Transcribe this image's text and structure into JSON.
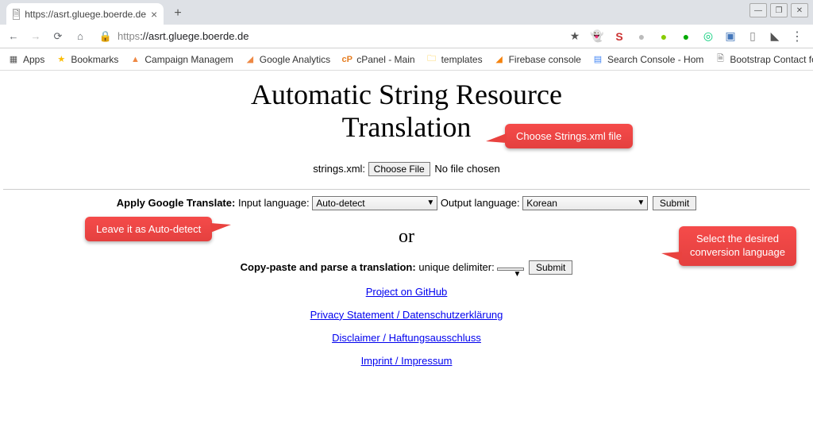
{
  "browser": {
    "tab_title": "https://asrt.gluege.boerde.de",
    "url_proto": "https",
    "url_rest": "://asrt.gluege.boerde.de",
    "new_tab": "+",
    "window_min": "—",
    "window_max": "❐",
    "window_close": "✕"
  },
  "bookmarks": {
    "apps": "Apps",
    "bm": "Bookmarks",
    "cm": "Campaign Managem",
    "ga": "Google Analytics",
    "cp": "cPanel - Main",
    "tmpl": "templates",
    "fb": "Firebase console",
    "sc": "Search Console - Hom",
    "bc": "Bootstrap Contact fo"
  },
  "ext": {
    "star": "★",
    "ghost": "👻",
    "s": "S",
    "g": "●",
    "grn1": "●",
    "grn2": "●",
    "grn3": "◎",
    "sq": "▣",
    "bar": "▯",
    "arrow": "◣"
  },
  "page": {
    "title_l1": "Automatic String Resource",
    "title_l2": "Translation",
    "file_label": "strings.xml:",
    "choose_file": "Choose File",
    "file_status": "No file chosen",
    "apply_label": "Apply Google Translate:",
    "input_lang_label": "Input language:",
    "input_lang_value": "Auto-detect",
    "output_lang_label": "Output language:",
    "output_lang_value": "Korean",
    "submit": "Submit",
    "or": "or",
    "copy_label": "Copy-paste and parse a translation:",
    "delim_label": "unique delimiter:",
    "delim_value": "",
    "link_github": "Project on GitHub",
    "link_privacy": "Privacy Statement / Datenschutzerklärung",
    "link_disclaimer": "Disclaimer / Haftungsausschluss",
    "link_imprint": "Imprint / Impressum"
  },
  "callouts": {
    "c1": "Choose Strings.xml file",
    "c2": "Leave it as Auto-detect",
    "c3_l1": "Select the desired",
    "c3_l2": "conversion language"
  }
}
